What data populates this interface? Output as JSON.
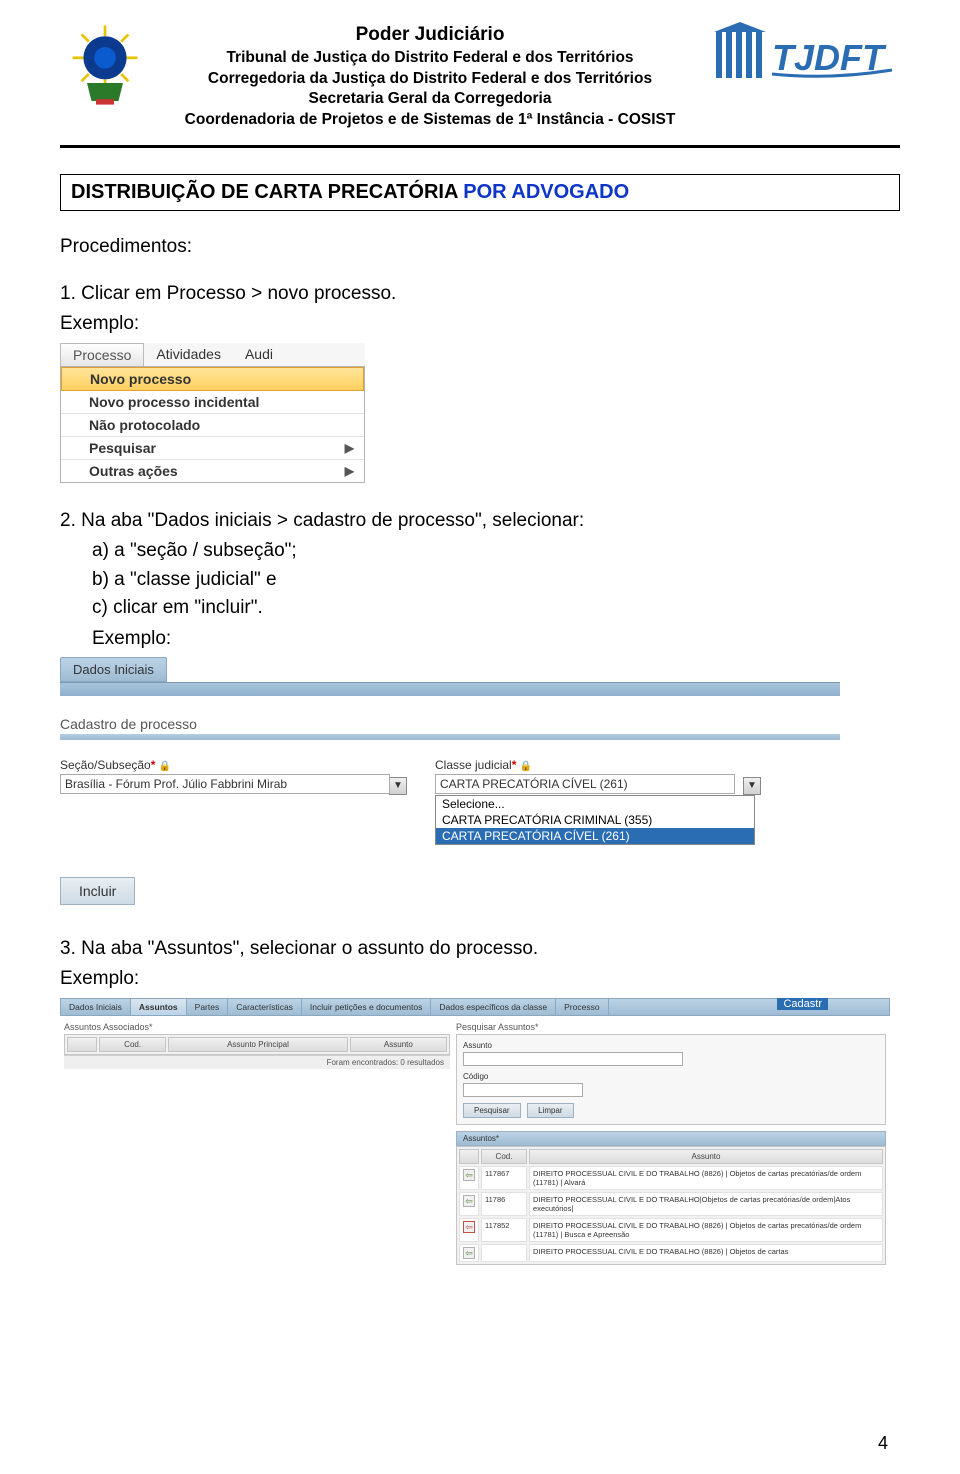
{
  "header": {
    "line1": "Poder Judiciário",
    "line2": "Tribunal de Justiça do Distrito Federal e dos Territórios",
    "line3": "Corregedoria da Justiça do Distrito Federal e dos Territórios",
    "line4": "Secretaria Geral da Corregedoria",
    "line5": "Coordenadoria de Projetos e de Sistemas de 1ª Instância - COSIST"
  },
  "title": {
    "black": "DISTRIBUIÇÃO DE CARTA PRECATÓRIA",
    "blue": "POR ADVOGADO"
  },
  "body": {
    "procedimentos": "Procedimentos:",
    "step1": "1. Clicar em Processo > novo processo.",
    "exemplo": "Exemplo:",
    "step2_intro": "2. Na aba \"Dados iniciais > cadastro de processo\", selecionar:",
    "step2_a": "a) a \"seção / subseção\";",
    "step2_b": "b) a \"classe judicial\" e",
    "step2_c": "c) clicar em \"incluir\".",
    "step3": "3. Na aba \"Assuntos\", selecionar o assunto do processo."
  },
  "ss1": {
    "tabs": {
      "processo": "Processo",
      "atividades": "Atividades",
      "audi": "Audi"
    },
    "items": {
      "novo": "Novo processo",
      "incidental": "Novo processo incidental",
      "nao_protocolado": "Não protocolado",
      "pesquisar": "Pesquisar",
      "outras": "Outras ações"
    }
  },
  "ss2": {
    "tab": "Dados Iniciais",
    "panel_title": "Cadastro de processo",
    "secao_label": "Seção/Subseção",
    "secao_value": "Brasília - Fórum Prof. Júlio Fabbrini Mirab",
    "classe_label": "Classe judicial",
    "classe_value": "CARTA PRECATÓRIA CÍVEL (261)",
    "ddlist": {
      "opt0": "Selecione...",
      "opt1": "CARTA PRECATÓRIA CRIMINAL (355)",
      "opt2": "CARTA PRECATÓRIA CÍVEL (261)"
    },
    "incluir": "Incluir",
    "star": "*",
    "lock": "🔒"
  },
  "ss3": {
    "tabs": {
      "dados": "Dados Iniciais",
      "assuntos": "Assuntos",
      "partes": "Partes",
      "carac": "Características",
      "incluir_pet": "Incluir petições e documentos",
      "dados_esp": "Dados específicos da classe",
      "processo": "Processo"
    },
    "cadastr": "Cadastr",
    "left_header": "Assuntos Associados*",
    "left_col_cod": "Cod.",
    "left_col_princ": "Assunto Principal",
    "left_col_assunto": "Assunto",
    "no_result": "Foram encontrados: 0 resultados",
    "right_header": "Pesquisar Assuntos*",
    "lbl_assunto": "Assunto",
    "lbl_codigo": "Código",
    "btn_pesquisar": "Pesquisar",
    "btn_limpar": "Limpar",
    "assuntos_bar": "Assuntos*",
    "col_cod": "Cod.",
    "col_assunto": "Assunto",
    "rows": [
      {
        "cod": "117867",
        "txt": "DIREITO PROCESSUAL CIVIL E DO TRABALHO (8826) | Objetos de cartas precatórias/de ordem (11781) | Alvará"
      },
      {
        "cod": "11786",
        "txt": "DIREITO PROCESSUAL CIVIL E DO TRABALHO|Objetos de cartas precatórias/de ordem|Atos executórios|"
      },
      {
        "cod": "117852",
        "txt": "DIREITO PROCESSUAL CIVIL E DO TRABALHO (8826) | Objetos de cartas precatórias/de ordem (11781) | Busca e Apreensão"
      },
      {
        "cod": "",
        "txt": "DIREITO PROCESSUAL CIVIL E DO TRABALHO (8826) | Objetos de cartas"
      }
    ]
  },
  "page_number": "4"
}
